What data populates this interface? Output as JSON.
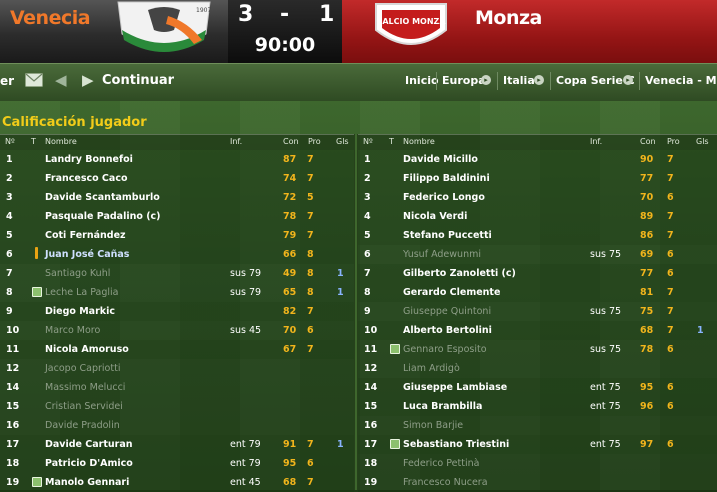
{
  "match": {
    "home_team": "Venecia",
    "away_team": "Monza",
    "home_score": "3",
    "separator": "-",
    "away_score": "1",
    "clock": "90:00",
    "home_crest_text": "1907",
    "away_crest_text": "CALCIO MONZA",
    "colors": {
      "home": "#f0782a",
      "away": "#b81c1c",
      "rating": "#f2b51c",
      "title": "#f2cc19"
    }
  },
  "nav": {
    "edge_text": "er",
    "continue_label": "Continuar",
    "breadcrumbs": [
      "Inicio",
      "Europa",
      "Italia",
      "Copa Serie C",
      "Venecia - Monza"
    ]
  },
  "section_title": "Calificación jugador",
  "columns": {
    "num": "Nº",
    "t": "T",
    "name": "Nombre",
    "inf": "Inf.",
    "con": "Con",
    "pro": "Pro",
    "gls": "Gls"
  },
  "home_players": [
    {
      "num": "1",
      "name": "Landry Bonnefoi",
      "inf": "",
      "con": "87",
      "pro": "7",
      "gls": "",
      "state": "lit",
      "icon": ""
    },
    {
      "num": "2",
      "name": "Francesco Caco",
      "inf": "",
      "con": "74",
      "pro": "7",
      "gls": "",
      "state": "lit",
      "icon": ""
    },
    {
      "num": "3",
      "name": "Davide Scantamburlo",
      "inf": "",
      "con": "72",
      "pro": "5",
      "gls": "",
      "state": "lit",
      "icon": ""
    },
    {
      "num": "4",
      "name": "Pasquale Padalino (c)",
      "inf": "",
      "con": "78",
      "pro": "7",
      "gls": "",
      "state": "lit",
      "icon": ""
    },
    {
      "num": "5",
      "name": "Coti Fernández",
      "inf": "",
      "con": "79",
      "pro": "7",
      "gls": "",
      "state": "lit",
      "icon": ""
    },
    {
      "num": "6",
      "name": "Juan José Cañas",
      "inf": "",
      "con": "66",
      "pro": "8",
      "gls": "",
      "state": "active",
      "icon": "bottle"
    },
    {
      "num": "7",
      "name": "Santiago Kuhl",
      "inf": "sus 79",
      "con": "49",
      "pro": "8",
      "gls": "1",
      "state": "dim",
      "icon": ""
    },
    {
      "num": "8",
      "name": "Leche La Paglia",
      "inf": "sus 79",
      "con": "65",
      "pro": "8",
      "gls": "1",
      "state": "dim",
      "icon": "sub"
    },
    {
      "num": "9",
      "name": "Diego Markic",
      "inf": "",
      "con": "82",
      "pro": "7",
      "gls": "",
      "state": "lit",
      "icon": ""
    },
    {
      "num": "10",
      "name": "Marco Moro",
      "inf": "sus 45",
      "con": "70",
      "pro": "6",
      "gls": "",
      "state": "dim",
      "icon": ""
    },
    {
      "num": "11",
      "name": "Nicola Amoruso",
      "inf": "",
      "con": "67",
      "pro": "7",
      "gls": "",
      "state": "lit",
      "icon": ""
    },
    {
      "num": "12",
      "name": "Jacopo Capriotti",
      "inf": "",
      "con": "",
      "pro": "",
      "gls": "",
      "state": "dim",
      "icon": ""
    },
    {
      "num": "14",
      "name": "Massimo Melucci",
      "inf": "",
      "con": "",
      "pro": "",
      "gls": "",
      "state": "dim",
      "icon": ""
    },
    {
      "num": "15",
      "name": "Cristian Servidei",
      "inf": "",
      "con": "",
      "pro": "",
      "gls": "",
      "state": "dim",
      "icon": ""
    },
    {
      "num": "16",
      "name": "Davide Pradolin",
      "inf": "",
      "con": "",
      "pro": "",
      "gls": "",
      "state": "dim",
      "icon": ""
    },
    {
      "num": "17",
      "name": "Davide Carturan",
      "inf": "ent 79",
      "con": "91",
      "pro": "7",
      "gls": "1",
      "state": "lit",
      "icon": ""
    },
    {
      "num": "18",
      "name": "Patricio D'Amico",
      "inf": "ent 79",
      "con": "95",
      "pro": "6",
      "gls": "",
      "state": "lit",
      "icon": ""
    },
    {
      "num": "19",
      "name": "Manolo Gennari",
      "inf": "ent 45",
      "con": "68",
      "pro": "7",
      "gls": "",
      "state": "lit",
      "icon": "sub"
    }
  ],
  "away_players": [
    {
      "num": "1",
      "name": "Davide Micillo",
      "inf": "",
      "con": "90",
      "pro": "7",
      "gls": "",
      "state": "lit",
      "icon": ""
    },
    {
      "num": "2",
      "name": "Filippo Baldinini",
      "inf": "",
      "con": "77",
      "pro": "7",
      "gls": "",
      "state": "lit",
      "icon": ""
    },
    {
      "num": "3",
      "name": "Federico Longo",
      "inf": "",
      "con": "70",
      "pro": "6",
      "gls": "",
      "state": "lit",
      "icon": ""
    },
    {
      "num": "4",
      "name": "Nicola Verdi",
      "inf": "",
      "con": "89",
      "pro": "7",
      "gls": "",
      "state": "lit",
      "icon": ""
    },
    {
      "num": "5",
      "name": "Stefano Puccetti",
      "inf": "",
      "con": "86",
      "pro": "7",
      "gls": "",
      "state": "lit",
      "icon": ""
    },
    {
      "num": "6",
      "name": "Yusuf Adewunmi",
      "inf": "sus 75",
      "con": "69",
      "pro": "6",
      "gls": "",
      "state": "dim",
      "icon": ""
    },
    {
      "num": "7",
      "name": "Gilberto Zanoletti (c)",
      "inf": "",
      "con": "77",
      "pro": "6",
      "gls": "",
      "state": "lit",
      "icon": ""
    },
    {
      "num": "8",
      "name": "Gerardo Clemente",
      "inf": "",
      "con": "81",
      "pro": "7",
      "gls": "",
      "state": "lit",
      "icon": ""
    },
    {
      "num": "9",
      "name": "Giuseppe Quintoni",
      "inf": "sus 75",
      "con": "75",
      "pro": "7",
      "gls": "",
      "state": "dim",
      "icon": ""
    },
    {
      "num": "10",
      "name": "Alberto Bertolini",
      "inf": "",
      "con": "68",
      "pro": "7",
      "gls": "1",
      "state": "lit",
      "icon": ""
    },
    {
      "num": "11",
      "name": "Gennaro Esposito",
      "inf": "sus 75",
      "con": "78",
      "pro": "6",
      "gls": "",
      "state": "dim",
      "icon": "sub"
    },
    {
      "num": "12",
      "name": "Liam Ardigò",
      "inf": "",
      "con": "",
      "pro": "",
      "gls": "",
      "state": "dim",
      "icon": ""
    },
    {
      "num": "14",
      "name": "Giuseppe Lambiase",
      "inf": "ent 75",
      "con": "95",
      "pro": "6",
      "gls": "",
      "state": "lit",
      "icon": ""
    },
    {
      "num": "15",
      "name": "Luca Brambilla",
      "inf": "ent 75",
      "con": "96",
      "pro": "6",
      "gls": "",
      "state": "lit",
      "icon": ""
    },
    {
      "num": "16",
      "name": "Simon Barjie",
      "inf": "",
      "con": "",
      "pro": "",
      "gls": "",
      "state": "dim",
      "icon": ""
    },
    {
      "num": "17",
      "name": "Sebastiano Triestini",
      "inf": "ent 75",
      "con": "97",
      "pro": "6",
      "gls": "",
      "state": "lit",
      "icon": "sub"
    },
    {
      "num": "18",
      "name": "Federico Pettinà",
      "inf": "",
      "con": "",
      "pro": "",
      "gls": "",
      "state": "dim",
      "icon": ""
    },
    {
      "num": "19",
      "name": "Francesco Nucera",
      "inf": "",
      "con": "",
      "pro": "",
      "gls": "",
      "state": "dim",
      "icon": ""
    }
  ]
}
